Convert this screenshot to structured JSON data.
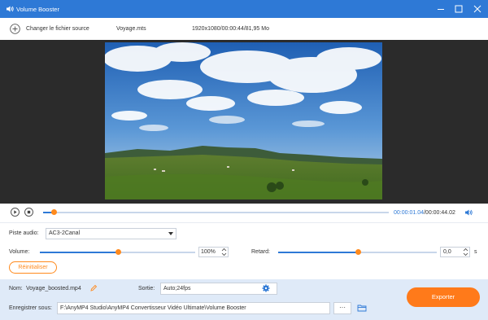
{
  "window": {
    "title": "Volume Booster",
    "controls": [
      "minimize-icon",
      "maximize-icon",
      "close-icon"
    ]
  },
  "source": {
    "change_label": "Changer le fichier source",
    "file_name": "Voyage.mts",
    "file_info": "1920x1080/00:00:44/81,95 Mo"
  },
  "playback": {
    "current_time": "00:00:01.04",
    "total_time": "/00:00:44.02",
    "progress": 0.03
  },
  "settings": {
    "audio_track_label": "Piste audio:",
    "audio_track_value": "AC3-2Canal",
    "volume_label": "Volume:",
    "volume_value": "100%",
    "volume_level": 0.5,
    "delay_label": "Retard:",
    "delay_value": "0,0",
    "delay_unit": "s",
    "delay_level": 0.5,
    "reset_label": "Réinitialiser"
  },
  "output": {
    "name_label": "Nom:",
    "name_value": "Voyage_boosted.mp4",
    "output_label": "Sortie:",
    "output_value": "Auto;24fps",
    "save_label": "Enregistrer sous:",
    "save_path": "F:\\AnyMP4 Studio\\AnyMP4 Convertisseur Vidéo Ultimate\\Volume Booster",
    "more_label": "···",
    "export_label": "Exporter"
  },
  "colors": {
    "accent": "#2e79d6",
    "orange": "#ff8a1d",
    "panel": "#dfeaf8"
  }
}
